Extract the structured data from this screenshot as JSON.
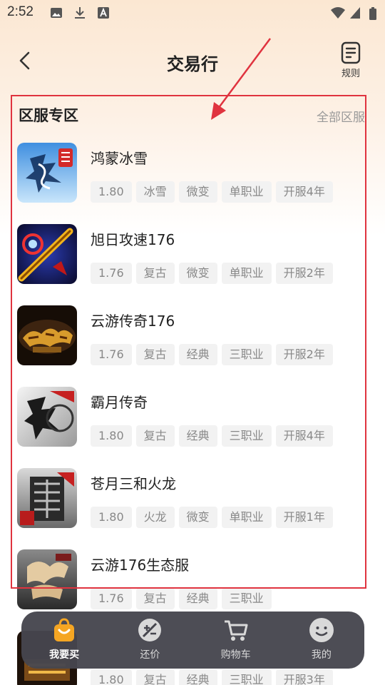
{
  "status_bar": {
    "time": "2:52"
  },
  "header": {
    "title": "交易行",
    "rules_label": "规则"
  },
  "section": {
    "title": "区服专区",
    "all_link": "全部区服"
  },
  "games": [
    {
      "name": "鸿蒙冰雪",
      "tags": [
        "1.80",
        "冰雪",
        "微变",
        "单职业",
        "开服4年"
      ]
    },
    {
      "name": "旭日攻速176",
      "tags": [
        "1.76",
        "复古",
        "微变",
        "单职业",
        "开服2年"
      ]
    },
    {
      "name": "云游传奇176",
      "tags": [
        "1.76",
        "复古",
        "经典",
        "三职业",
        "开服2年"
      ]
    },
    {
      "name": "霸月传奇",
      "tags": [
        "1.80",
        "复古",
        "经典",
        "三职业",
        "开服4年"
      ]
    },
    {
      "name": "苍月三和火龙",
      "tags": [
        "1.80",
        "火龙",
        "微变",
        "单职业",
        "开服1年"
      ]
    },
    {
      "name": "云游176生态服",
      "tags": [
        "1.76",
        "复古",
        "经典",
        "三职业"
      ]
    },
    {
      "name": "",
      "tags": [
        "1.80",
        "复古",
        "经典",
        "三职业",
        "开服3年"
      ]
    }
  ],
  "bottom_nav": [
    {
      "label": "我要买",
      "icon": "shopping-bag-icon",
      "active": true
    },
    {
      "label": "还价",
      "icon": "bargain-icon",
      "active": false
    },
    {
      "label": "购物车",
      "icon": "cart-icon",
      "active": false
    },
    {
      "label": "我的",
      "icon": "profile-icon",
      "active": false
    }
  ],
  "colors": {
    "highlight": "#e0333f",
    "accent": "#f5a623",
    "nav_bg": "#46464e"
  }
}
